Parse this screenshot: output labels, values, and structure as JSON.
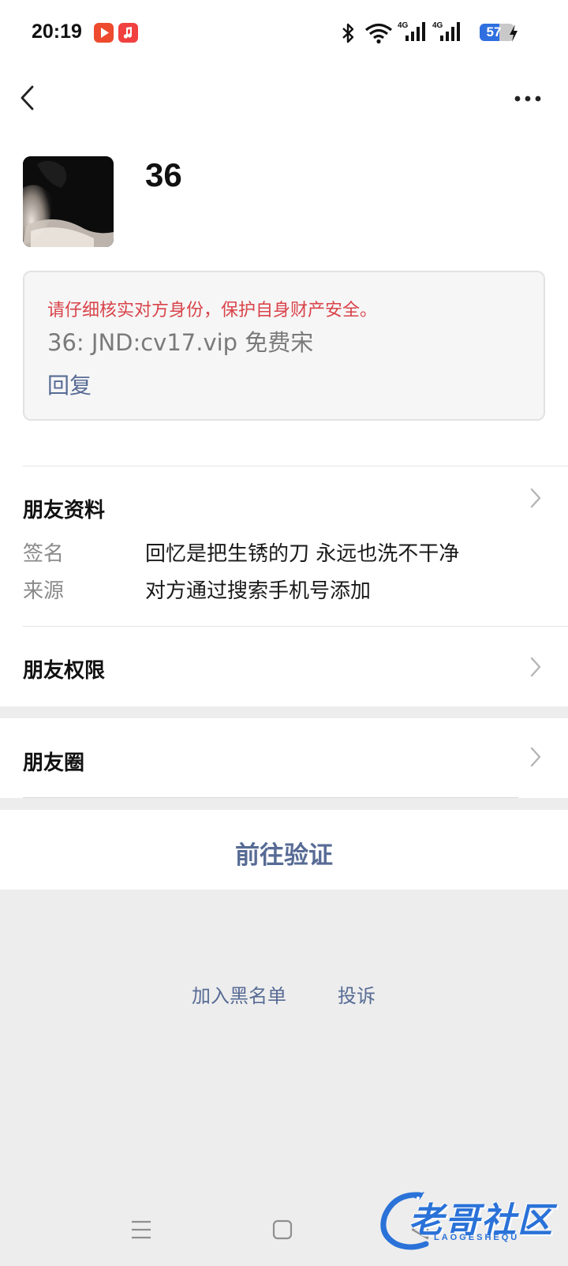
{
  "status_bar": {
    "time": "20:19",
    "battery": "57",
    "battery_level_percent": 57,
    "network_labels": [
      "4G",
      "4G"
    ],
    "icons": [
      "video-app-icon",
      "music-app-icon",
      "bluetooth-icon",
      "wifi-icon",
      "signal-icon",
      "signal-icon",
      "battery-icon",
      "charging-icon"
    ]
  },
  "header": {
    "back_icon": "chevron-left-icon",
    "more_icon": "more-dots-icon"
  },
  "profile": {
    "name": "36"
  },
  "verification": {
    "warning": "请仔细核实对方身份，保护自身财产安全。",
    "message": "36: JND:cv17.vip 免费宋",
    "reply_label": "回复"
  },
  "friend_info": {
    "title": "朋友资料",
    "fields": [
      {
        "label": "签名",
        "value": "回忆是把生锈的刀 永远也洗不干净"
      },
      {
        "label": "来源",
        "value": "对方通过搜索手机号添加"
      }
    ]
  },
  "permissions": {
    "title": "朋友权限"
  },
  "moments": {
    "title": "朋友圈"
  },
  "verify_action": {
    "label": "前往验证"
  },
  "footer_links": {
    "blacklist": "加入黑名单",
    "report": "投诉"
  },
  "watermark": {
    "title": "老哥社区",
    "subtitle": "LAOGESHEQU"
  },
  "colors": {
    "link": "#576b95",
    "warning": "#d9434a",
    "background": "#ededed"
  }
}
